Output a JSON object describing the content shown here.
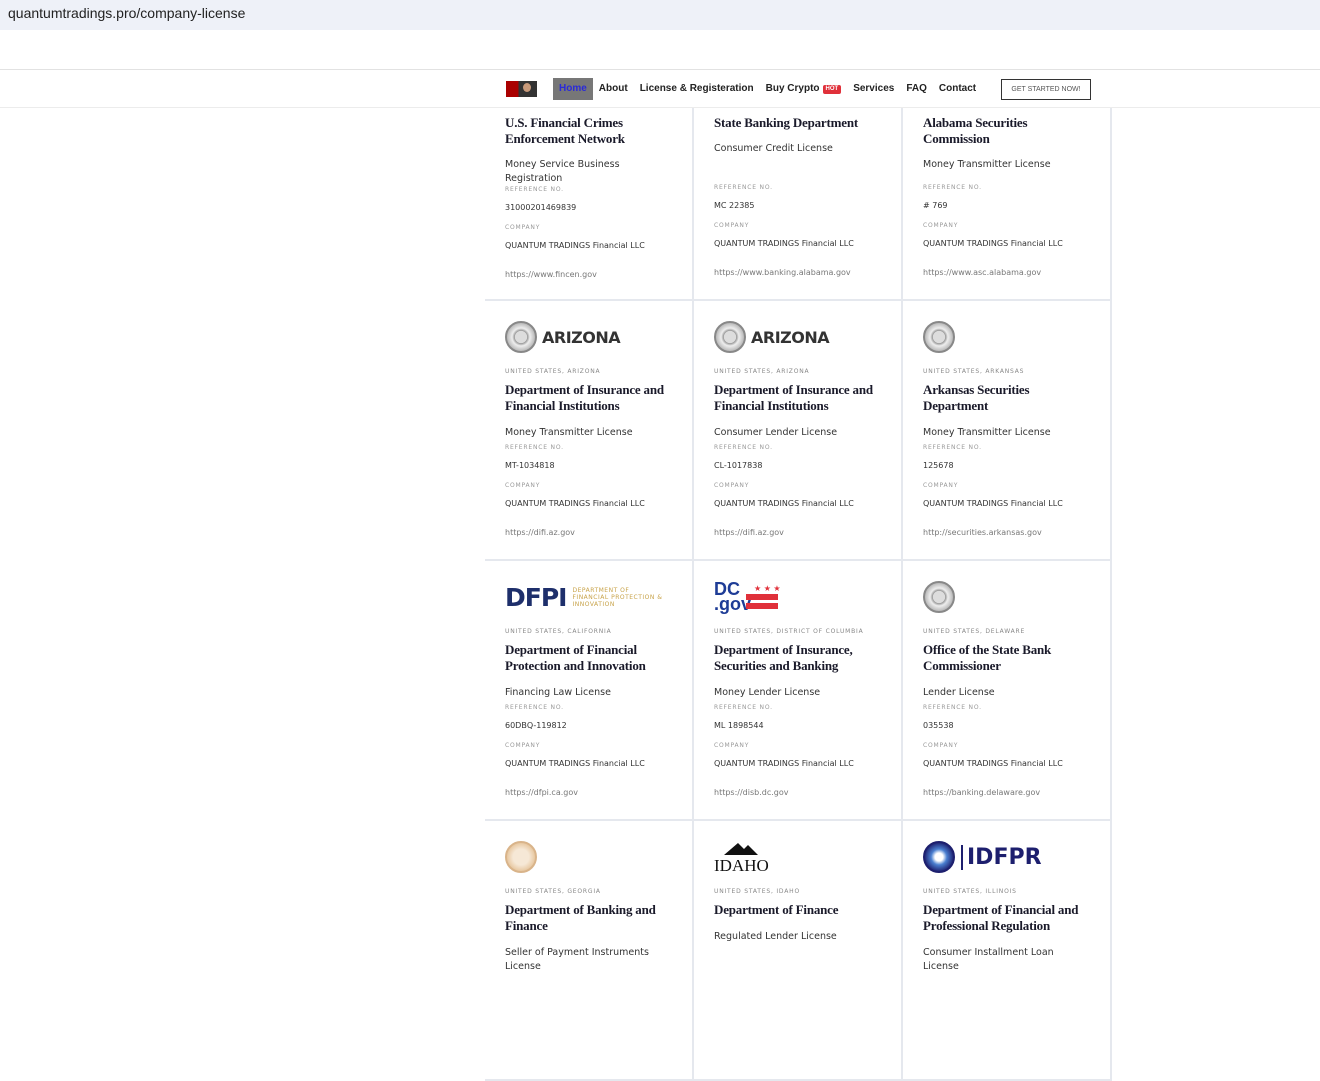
{
  "browser": {
    "url": "quantumtradings.pro/company-license"
  },
  "nav": {
    "items": [
      "Home",
      "About",
      "License & Registeration",
      "Buy Crypto",
      "Services",
      "FAQ",
      "Contact"
    ],
    "hot_badge": "HOT",
    "cta": "GET STARTED NOW!"
  },
  "labels": {
    "reference": "Reference No.",
    "company": "Company"
  },
  "cards": [
    {
      "title": "U.S. Financial Crimes Enforcement Network",
      "license": "Money Service Business Registration",
      "ref": "31000201469839",
      "company": "QUANTUM TRADINGS Financial LLC",
      "url": "https://www.fincen.gov"
    },
    {
      "title": "State Banking Department",
      "license": "Consumer Credit License",
      "ref": "MC 22385",
      "company": "QUANTUM TRADINGS Financial LLC",
      "url": "https://www.banking.alabama.gov"
    },
    {
      "title": "Alabama Securities Commission",
      "license": "Money Transmitter License",
      "ref": "# 769",
      "company": "QUANTUM TRADINGS Financial LLC",
      "url": "https://www.asc.alabama.gov"
    },
    {
      "logo": "ARIZONA",
      "country": "United States, Arizona",
      "title": "Department of Insurance and Financial Institutions",
      "license": "Money Transmitter License",
      "ref": "MT-1034818",
      "company": "QUANTUM TRADINGS Financial LLC",
      "url": "https://difi.az.gov"
    },
    {
      "logo": "ARIZONA",
      "country": "United States, Arizona",
      "title": "Department of Insurance and Financial Institutions",
      "license": "Consumer Lender License",
      "ref": "CL-1017838",
      "company": "QUANTUM TRADINGS Financial LLC",
      "url": "https://difi.az.gov"
    },
    {
      "country": "United States, Arkansas",
      "title": "Arkansas Securities Department",
      "license": "Money Transmitter License",
      "ref": "125678",
      "company": "QUANTUM TRADINGS Financial LLC",
      "url": "http://securities.arkansas.gov"
    },
    {
      "logo": "DFPI",
      "logo_sub": "DEPARTMENT OF FINANCIAL PROTECTION & INNOVATION",
      "country": "United States, California",
      "title": "Department of Financial Protection and Innovation",
      "license": "Financing Law License",
      "ref": "60DBQ-119812",
      "company": "QUANTUM TRADINGS Financial LLC",
      "url": "https://dfpi.ca.gov"
    },
    {
      "logo": "DC .gov",
      "country": "United States, District of Columbia",
      "title": "Department of Insurance, Securities and Banking",
      "license": "Money Lender License",
      "ref": "ML 1898544",
      "company": "QUANTUM TRADINGS Financial LLC",
      "url": "https://disb.dc.gov"
    },
    {
      "country": "United States, Delaware",
      "title": "Office of the State Bank Commissioner",
      "license": "Lender License",
      "ref": "035538",
      "company": "QUANTUM TRADINGS Financial LLC",
      "url": "https://banking.delaware.gov"
    },
    {
      "country": "United States, Georgia",
      "title": "Department of Banking and Finance",
      "license": "Seller of Payment Instruments License"
    },
    {
      "logo": "IDAHO",
      "country": "United States, Idaho",
      "title": "Department of Finance",
      "license": "Regulated Lender License"
    },
    {
      "logo": "IDFPR",
      "country": "United States, Illinois",
      "title": "Department of Financial and Professional Regulation",
      "license": "Consumer Installment Loan License"
    }
  ]
}
